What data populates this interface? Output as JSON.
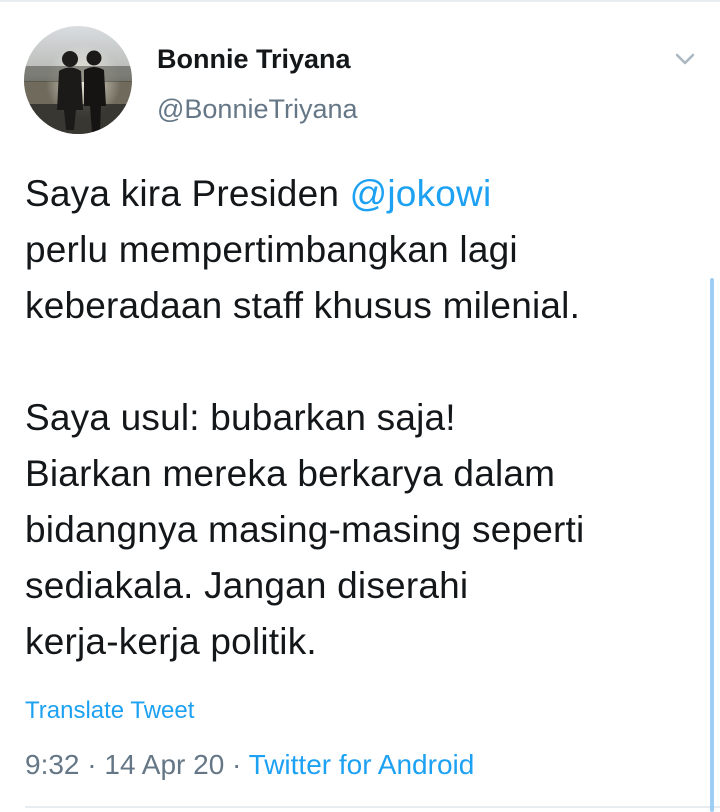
{
  "tweet": {
    "author_name": "Bonnie Triyana",
    "author_handle": "@BonnieTriyana",
    "text_line1_prefix": "Saya kira Presiden ",
    "text_line1_mention": "@jokowi",
    "text_line2": "perlu mempertimbangkan lagi",
    "text_line3": "keberadaan staff khusus milenial.",
    "text_line4": "Saya usul: bubarkan saja!",
    "text_line5": "Biarkan mereka berkarya dalam",
    "text_line6": "bidangnya masing-masing seperti",
    "text_line7": "sediakala. Jangan diserahi",
    "text_line8": "kerja-kerja politik.",
    "translate_label": "Translate Tweet",
    "time": "9:32",
    "separator": "·",
    "date": "14 Apr 20",
    "source": "Twitter for Android"
  },
  "icons": {
    "menu": "chevron-down-icon",
    "avatar": "avatar"
  },
  "colors": {
    "link": "#1da1f2",
    "text": "#14171a",
    "muted": "#657786",
    "border": "#e6ecf0"
  }
}
